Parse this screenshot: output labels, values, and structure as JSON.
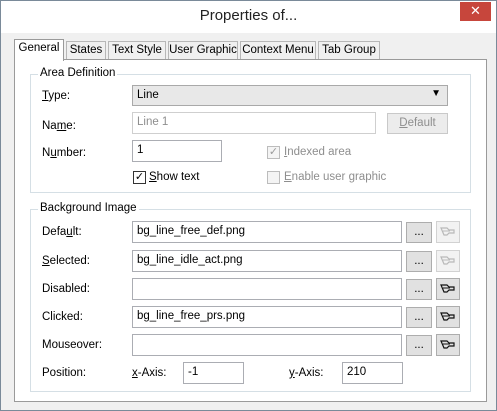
{
  "window": {
    "title": "Properties of...",
    "close_glyph": "✕"
  },
  "tabs": [
    {
      "label": "General"
    },
    {
      "label": "States"
    },
    {
      "label": "Text Style"
    },
    {
      "label": "User Graphic"
    },
    {
      "label": "Context Menu"
    },
    {
      "label": "Tab Group"
    }
  ],
  "area_definition": {
    "title": "Area Definition",
    "type_label_u": "T",
    "type_label_rest": "ype:",
    "type_value": "Line",
    "name_label_pre": "Na",
    "name_label_u": "m",
    "name_label_rest": "e:",
    "name_value": "Line 1",
    "default_btn_u": "D",
    "default_btn_rest": "efault",
    "number_label_pre": "N",
    "number_label_u": "u",
    "number_label_rest": "mber:",
    "number_value": "1",
    "indexed_label_u": "I",
    "indexed_label_rest": "ndexed area",
    "indexed_checked": true,
    "show_text_label_u": "S",
    "show_text_label_rest": "how text",
    "show_text_checked": true,
    "enable_graphic_label_u": "E",
    "enable_graphic_label_rest": "nable user graphic",
    "enable_graphic_checked": false
  },
  "background_image": {
    "title": "Background Image",
    "rows": [
      {
        "label_pre": "Defa",
        "label_u": "u",
        "label_rest": "lt:",
        "value": "bg_line_free_def.png",
        "browse": "...",
        "picker_enabled": false
      },
      {
        "label_pre": "",
        "label_u": "S",
        "label_rest": "elected:",
        "value": "bg_line_idle_act.png",
        "browse": "...",
        "picker_enabled": false
      },
      {
        "label_pre": "Disabled:",
        "label_u": "",
        "label_rest": "",
        "value": "",
        "browse": "...",
        "picker_enabled": true
      },
      {
        "label_pre": "Clicked:",
        "label_u": "",
        "label_rest": "",
        "value": "bg_line_free_prs.png",
        "browse": "...",
        "picker_enabled": true
      },
      {
        "label_pre": "Mouseover:",
        "label_u": "",
        "label_rest": "",
        "value": "",
        "browse": "...",
        "picker_enabled": true
      }
    ],
    "position_label": "Position:",
    "x_label_u": "x",
    "x_label_rest": "-Axis:",
    "x_value": "-1",
    "y_label_u": "y",
    "y_label_rest": "-Axis:",
    "y_value": "210"
  },
  "icons": {
    "picker": "eyedropper-icon",
    "dropdown": "chevron-down-icon",
    "check": "✓"
  }
}
